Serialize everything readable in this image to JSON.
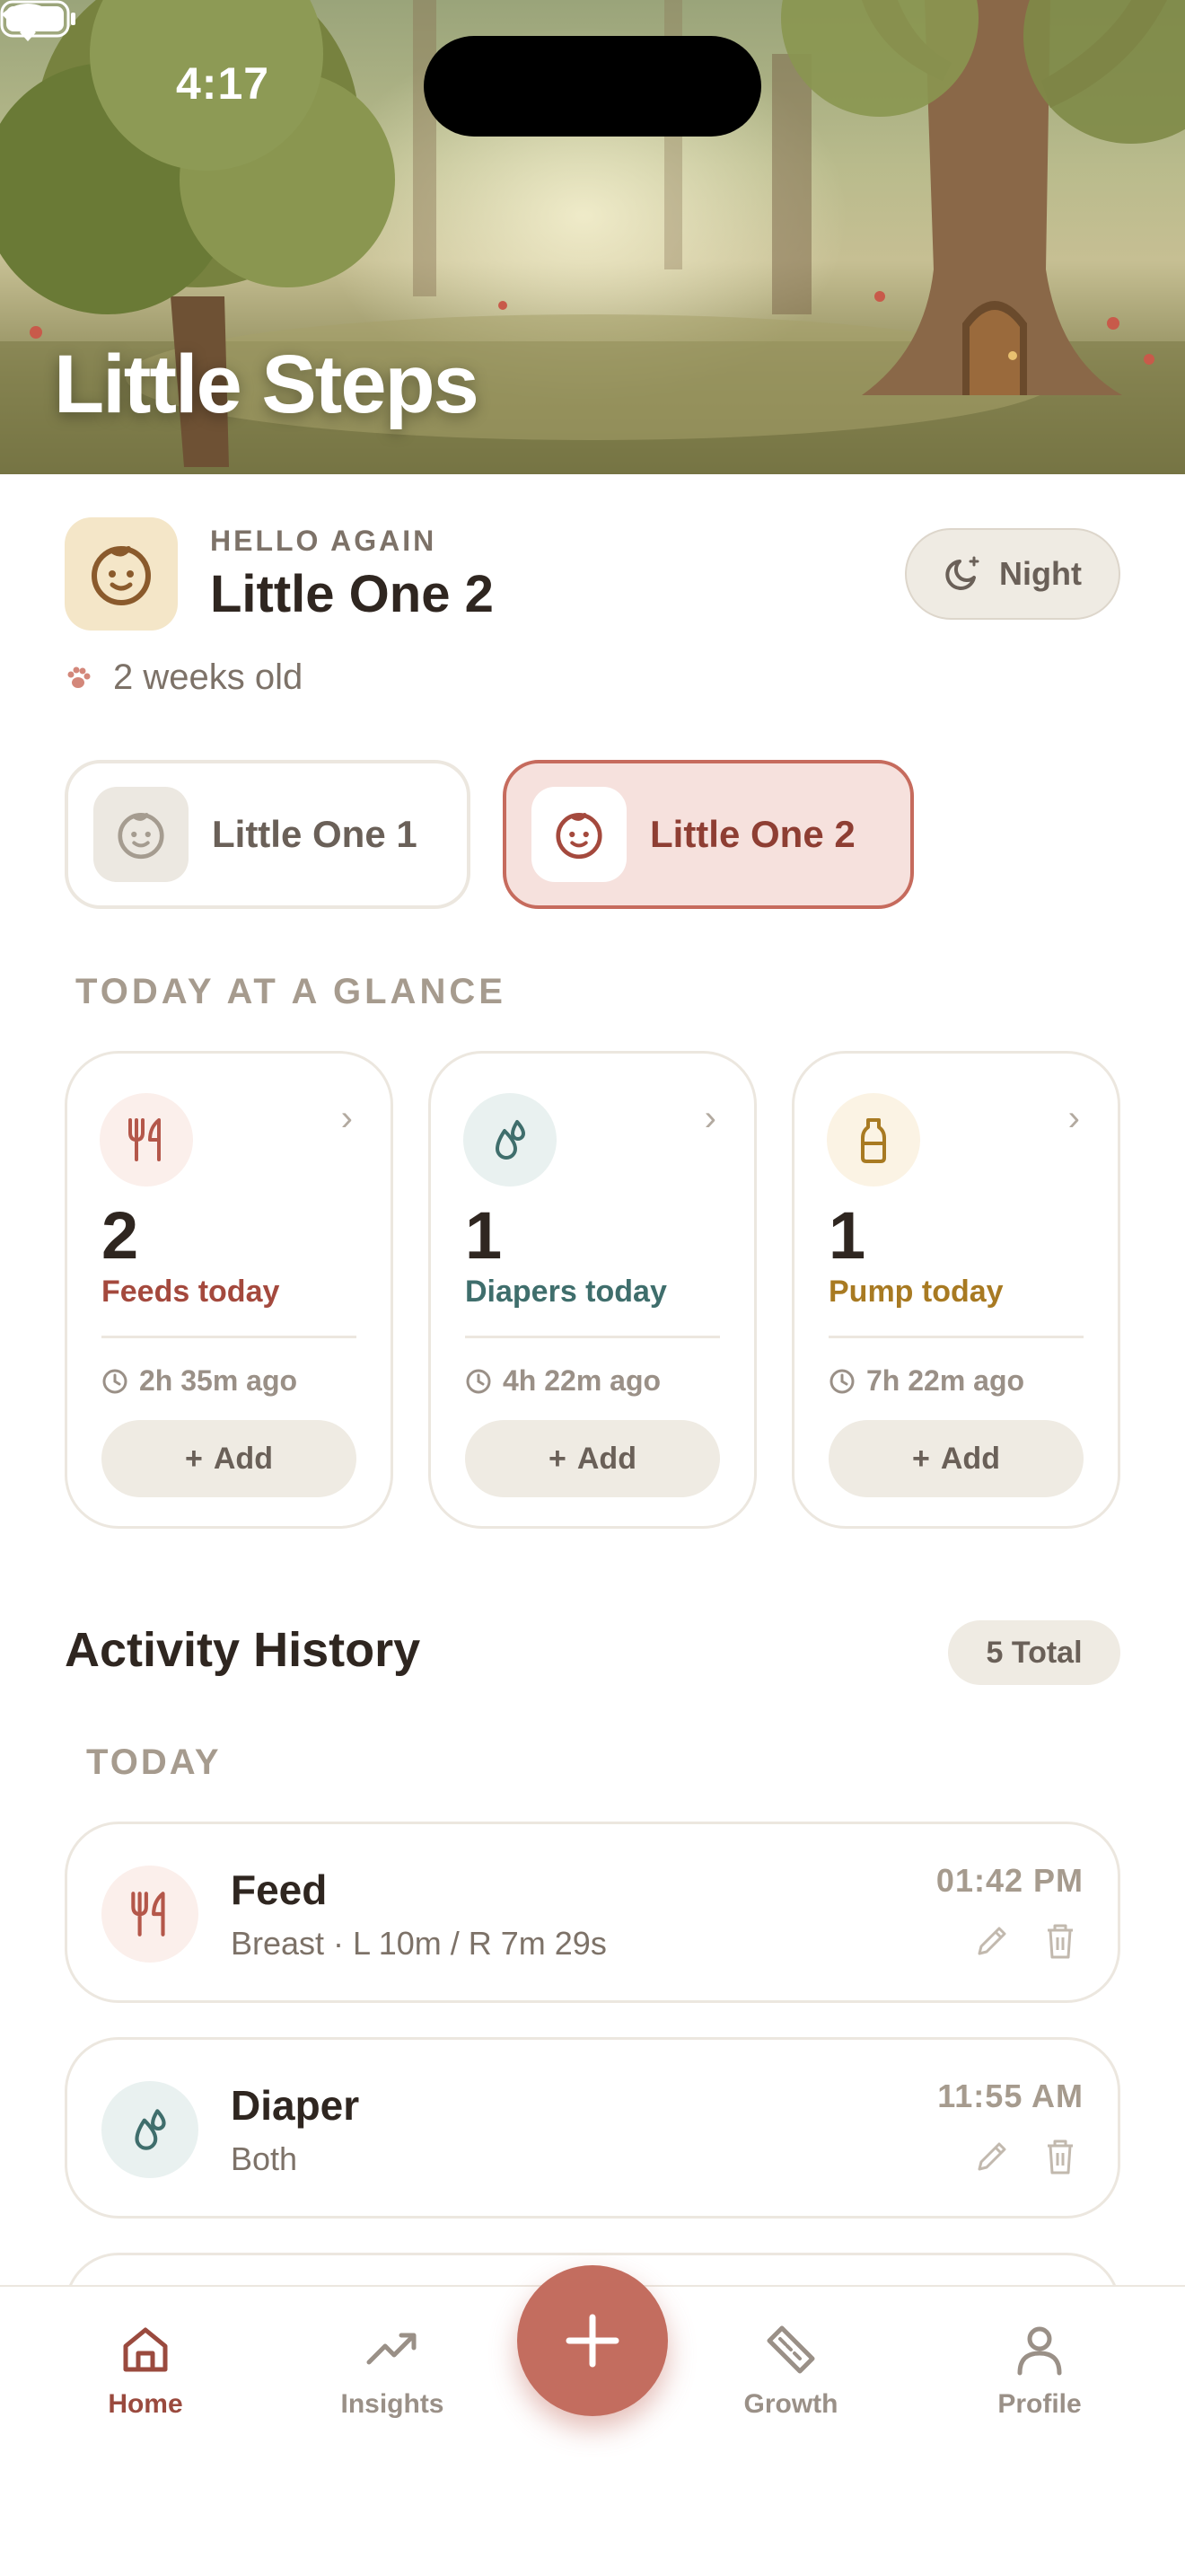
{
  "status_bar": {
    "time": "4:17"
  },
  "hero": {
    "title": "Little Steps"
  },
  "profile": {
    "greeting": "HELLO AGAIN",
    "name": "Little One 2",
    "age": "2 weeks old",
    "night_button": "Night"
  },
  "babies": [
    {
      "name": "Little One 1",
      "selected": false
    },
    {
      "name": "Little One 2",
      "selected": true
    }
  ],
  "glance": {
    "title": "TODAY AT A GLANCE",
    "cards": [
      {
        "icon": "fork-knife-icon",
        "count": "2",
        "label": "Feeds today",
        "ago": "2h 35m ago",
        "add": "Add",
        "color": "#a4493d"
      },
      {
        "icon": "droplets-icon",
        "count": "1",
        "label": "Diapers today",
        "ago": "4h 22m ago",
        "add": "Add",
        "color": "#3f6e6c"
      },
      {
        "icon": "bottle-icon",
        "count": "1",
        "label": "Pump today",
        "ago": "7h 22m ago",
        "add": "Add",
        "color": "#a87a22"
      }
    ]
  },
  "history": {
    "title": "Activity History",
    "total": "5 Total",
    "group": "TODAY",
    "items": [
      {
        "icon": "fork-knife-icon",
        "title": "Feed",
        "detail": "Breast · L 10m / R 7m 29s",
        "time": "01:42 PM"
      },
      {
        "icon": "droplets-icon",
        "title": "Diaper",
        "detail": "Both",
        "time": "11:55 AM"
      }
    ]
  },
  "tabs": [
    {
      "label": "Home",
      "icon": "home-icon",
      "active": true
    },
    {
      "label": "Insights",
      "icon": "trend-icon",
      "active": false
    },
    {
      "label": "Growth",
      "icon": "ruler-icon",
      "active": false
    },
    {
      "label": "Profile",
      "icon": "person-icon",
      "active": false
    }
  ],
  "colors": {
    "accent": "#c36d5f",
    "feed": "#a4493d",
    "diaper": "#3f6e6c",
    "pump": "#a87a22"
  }
}
